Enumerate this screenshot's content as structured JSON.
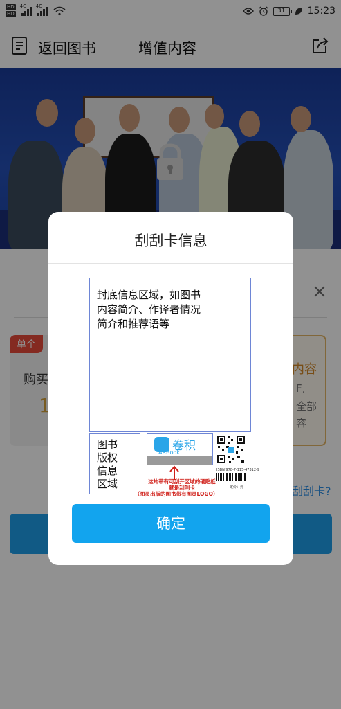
{
  "status_bar": {
    "hd1": "HD",
    "hd2": "HD",
    "net1": "4G",
    "net2": "4G",
    "battery": "31",
    "time": "15:23"
  },
  "header": {
    "back_label": "返回图书",
    "title": "增值内容"
  },
  "sheet": {
    "badge": "单个",
    "buy_label": "购买",
    "price_digit": "1",
    "right_title": "内容",
    "right_line1": "F,",
    "right_line2": "全部",
    "right_line3": "容",
    "scratch_link": "刮刮卡?"
  },
  "dialog": {
    "title": "刮刮卡信息",
    "cover_text": "封底信息区域，如图书内容简介、作译者情况简介和推荐语等",
    "copyright_text": "图书版权信息区域",
    "arbook_name": "卷积",
    "arbook_sub": "ARBook",
    "note_line1": "这片带有可刮开区域的硬贴纸",
    "note_line2": "就是刮刮卡",
    "note_line3": "（图灵出版的图书带有图灵LOGO）",
    "isbn": "ISBN 978-7-115-47312-9",
    "price": "定价：元",
    "confirm_label": "确定"
  },
  "colors": {
    "accent_blue": "#12a4ee",
    "badge_red": "#e84a3a",
    "price_gold": "#d4a13a",
    "note_red": "#d0201a"
  },
  "icons": {
    "back": "book-list-icon",
    "share": "share-icon",
    "lock": "lock-icon",
    "close": "close-icon"
  }
}
